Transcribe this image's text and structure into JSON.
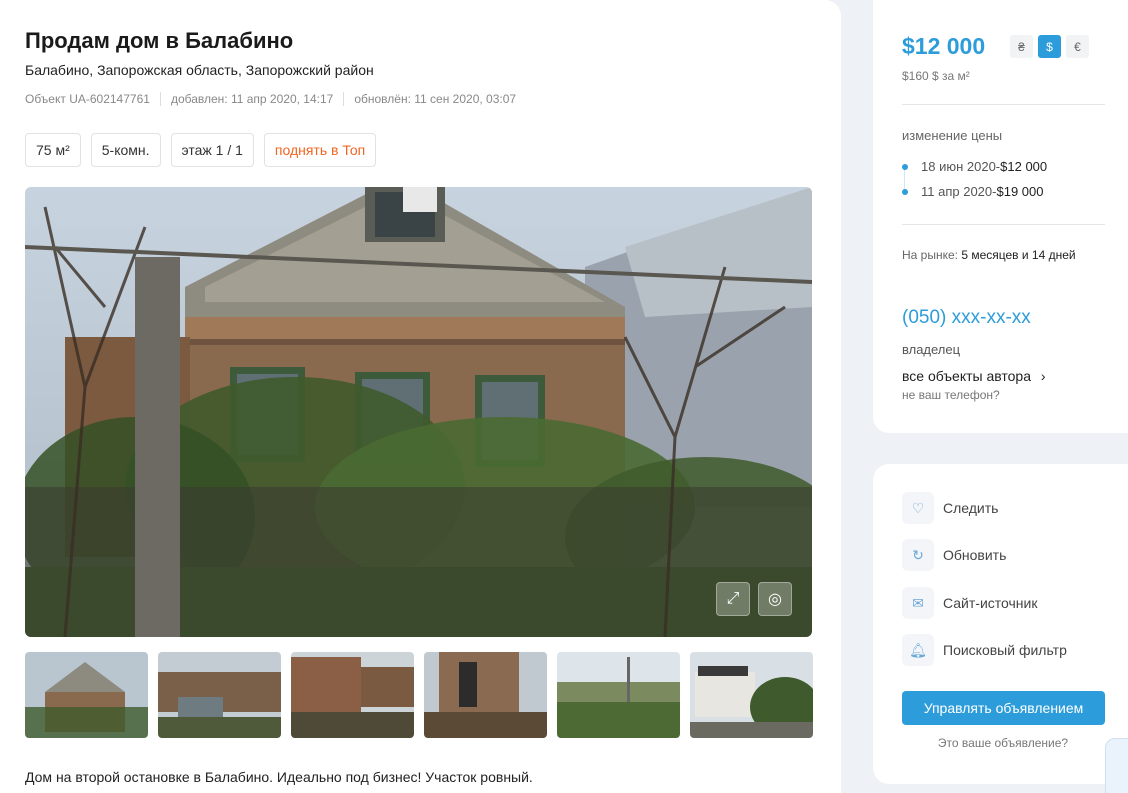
{
  "listing": {
    "title": "Продам дом в Балабино",
    "address": "Балабино, Запорожская область, Запорожский район",
    "object_id": "Объект UA-602147761",
    "added": "добавлен: 11 апр 2020, 14:17",
    "updated": "обновлён: 11 сен 2020, 03:07",
    "chips": [
      "75 м²",
      "5-комн.",
      "этаж 1 / 1"
    ],
    "promote_label": "поднять в Топ",
    "description": "Дом на второй остановке в Балабино. Идеально под бизнес! Участок ровный."
  },
  "photos": {
    "main_alt": "house photo",
    "fullscreen_icon": "expand-icon",
    "fingerprint_icon": "fingerprint-icon",
    "thumbnails_count": 6
  },
  "price": {
    "value": "$12 000",
    "currencies": [
      "₴",
      "$",
      "€"
    ],
    "active_currency": "$",
    "per_meter": "$160 $ за м²"
  },
  "price_history": {
    "title": "изменение цены",
    "entries": [
      {
        "date": "18 июн 2020",
        "sep": " - ",
        "price": "$12 000"
      },
      {
        "date": "11 апр 2020",
        "sep": " - ",
        "price": "$19 000"
      }
    ]
  },
  "market": {
    "label": "На рынке: ",
    "value": "5 месяцев и 14 дней"
  },
  "contact": {
    "phone": "(050) xxx-xx-xx",
    "role": "владелец",
    "all_objects": "все объекты автора",
    "not_your_phone": "не ваш телефон?"
  },
  "actions": [
    {
      "label": "Следить",
      "icon": "heart-icon"
    },
    {
      "label": "Обновить",
      "icon": "refresh-icon"
    },
    {
      "label": "Сайт-источник",
      "icon": "mail-icon"
    },
    {
      "label": "Поисковый фильтр",
      "icon": "bell-icon"
    }
  ],
  "manage": {
    "label": "Управлять объявлением",
    "your_ad": "Это ваше объявление?"
  },
  "colors": {
    "accent": "#2d9cdb",
    "promo": "#f26522"
  }
}
